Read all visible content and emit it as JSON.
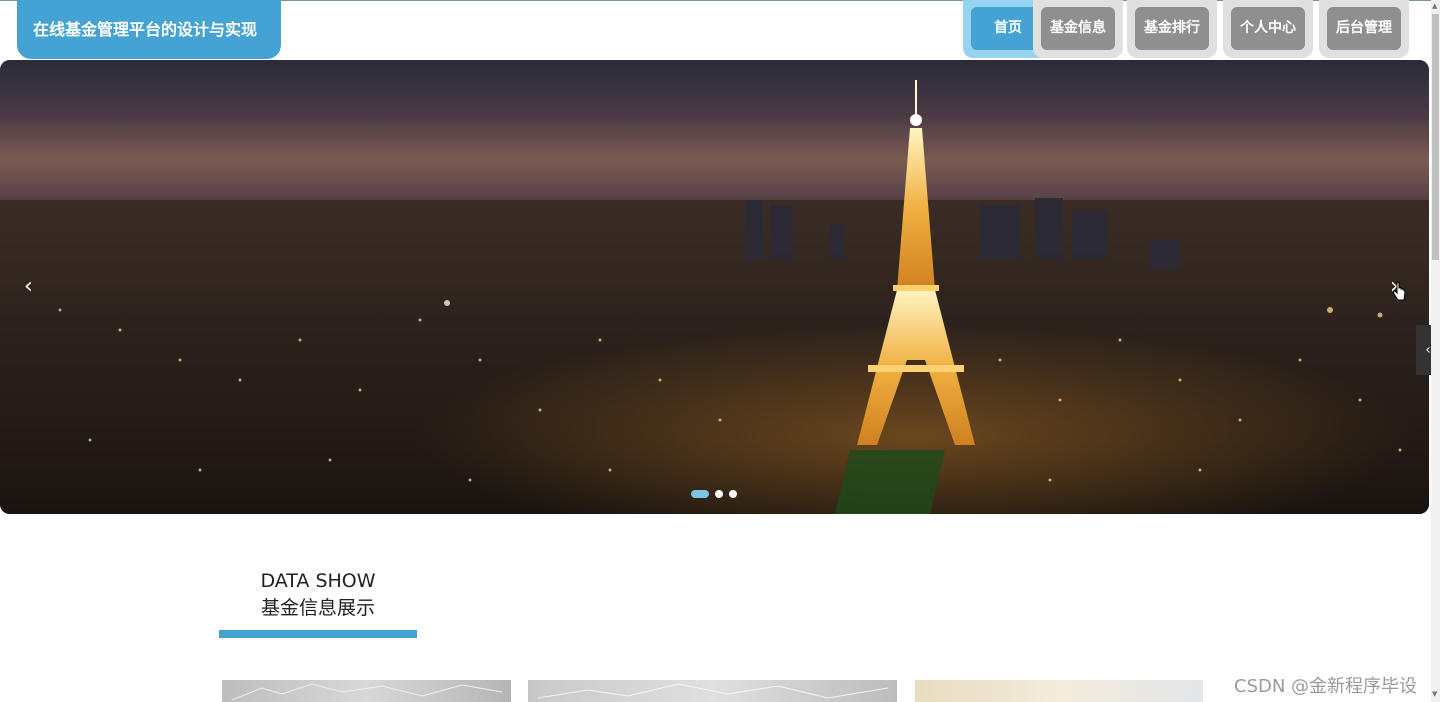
{
  "header": {
    "site_title": "在线基金管理平台的设计与实现"
  },
  "nav": {
    "items": [
      {
        "label": "首页",
        "active": true
      },
      {
        "label": "基金信息",
        "active": false
      },
      {
        "label": "基金排行",
        "active": false
      },
      {
        "label": "个人中心",
        "active": false
      },
      {
        "label": "后台管理",
        "active": false
      }
    ]
  },
  "banner": {
    "prev_label": "‹",
    "next_label": "›",
    "slide_count": 3,
    "active_slide": 1,
    "image": "paris-eiffel-tower-night-skyline"
  },
  "section": {
    "title_en": "DATA SHOW",
    "title_cn": "基金信息展示"
  },
  "side_tab": {
    "label": "‹"
  },
  "watermark": {
    "text": "CSDN @金新程序毕设"
  },
  "colors": {
    "accent": "#44a3d3",
    "accent_light": "#96d3ee",
    "nav_inactive": "#8f8f8f"
  }
}
